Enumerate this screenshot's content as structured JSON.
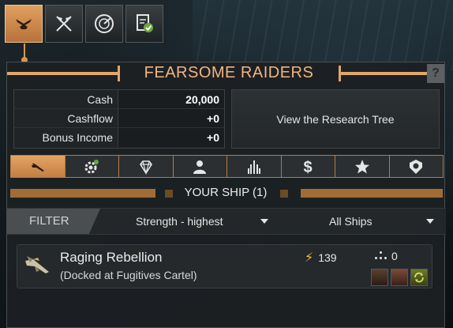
{
  "top_tabs": [
    {
      "icon": "raider-emblem-icon",
      "active": true
    },
    {
      "icon": "crossed-flags-icon",
      "active": false
    },
    {
      "icon": "radar-icon",
      "active": false
    },
    {
      "icon": "contract-check-icon",
      "active": false
    }
  ],
  "panel": {
    "title": "FEARSOME RAIDERS",
    "help_label": "?"
  },
  "finance": {
    "cash_label": "Cash",
    "cash_value": "20,000",
    "cashflow_label": "Cashflow",
    "cashflow_value": "+0",
    "bonus_label": "Bonus Income",
    "bonus_value": "+0"
  },
  "research_button": "View the Research Tree",
  "category_tabs": [
    {
      "icon": "ship-icon",
      "active": true
    },
    {
      "icon": "gear-icon",
      "active": false
    },
    {
      "icon": "diamond-icon",
      "active": false
    },
    {
      "icon": "person-icon",
      "active": false
    },
    {
      "icon": "factory-icon",
      "active": false
    },
    {
      "icon": "dollar-icon",
      "active": false
    },
    {
      "icon": "star-icon",
      "active": false
    },
    {
      "icon": "badge-icon",
      "active": false
    }
  ],
  "ships_section": {
    "header": "YOUR SHIP (1)",
    "filter_label": "FILTER",
    "sort_value": "Strength - highest",
    "type_value": "All Ships"
  },
  "ships": [
    {
      "name": "Raging Rebellion",
      "location": "(Docked at Fugitives Cartel)",
      "strength": "139",
      "crew": "0"
    }
  ],
  "colors": {
    "accent": "#e2a66a",
    "accent_dark": "#a26c35",
    "panel_bg": "#1c2023",
    "strength_bolt": "#f2c230"
  }
}
